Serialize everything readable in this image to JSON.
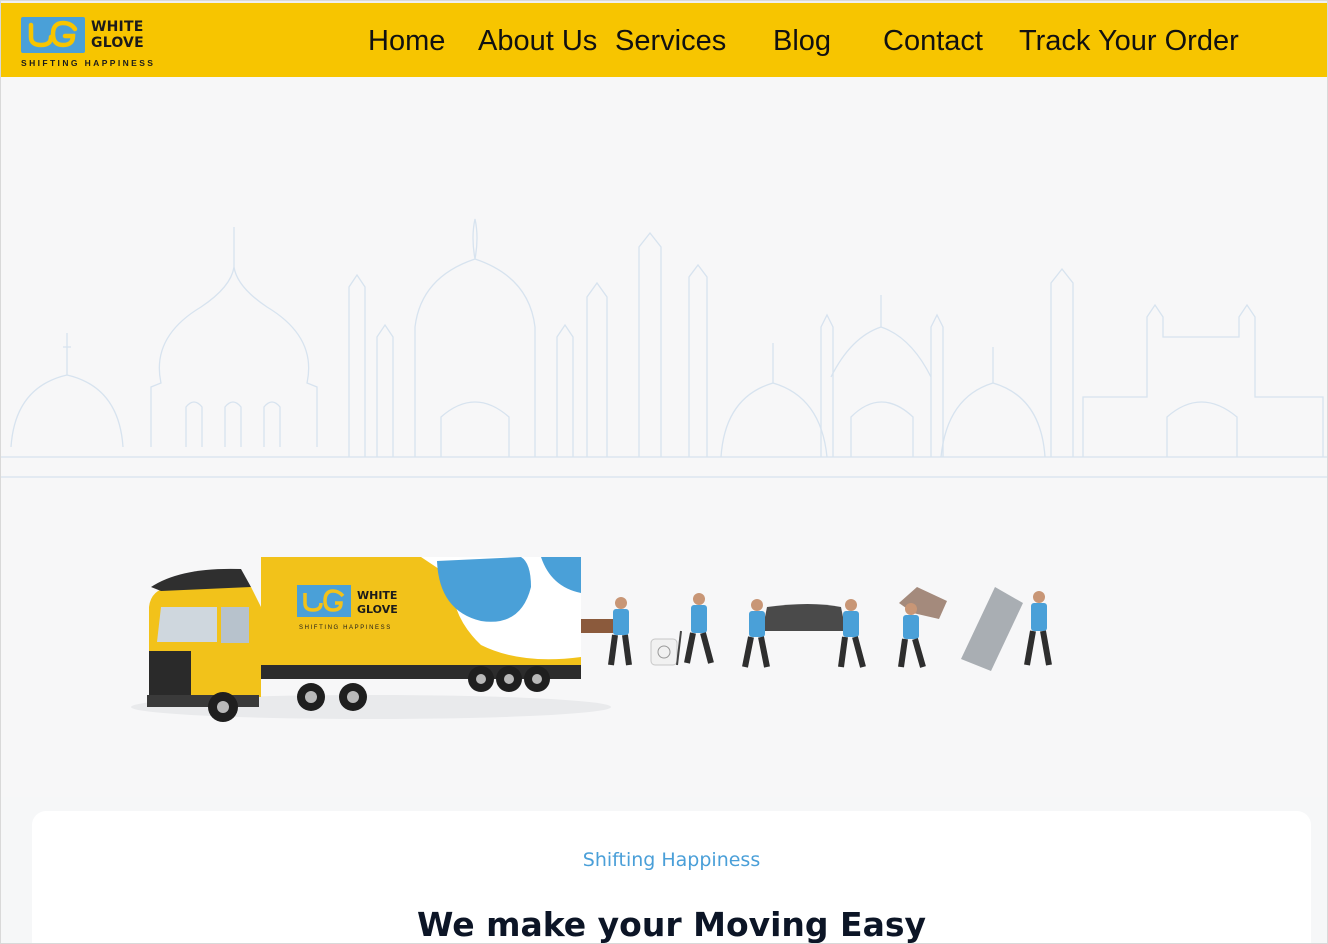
{
  "brand": {
    "name_line1": "WHITE",
    "name_line2": "GLOVE",
    "tagline": "SHIFTING HAPPINESS",
    "truck_name_line1": "WHITE",
    "truck_name_line2": "GLOVE",
    "truck_tagline": "SHIFTING HAPPINESS",
    "primary_color": "#f7c500",
    "accent_color": "#4aa0d8"
  },
  "nav": {
    "items": [
      {
        "label": "Home"
      },
      {
        "label": "About Us"
      },
      {
        "label": "Services"
      },
      {
        "label": "Blog"
      },
      {
        "label": "Contact"
      },
      {
        "label": "Track Your Order"
      }
    ]
  },
  "hero": {
    "illustration": "skyline-icon",
    "scene": "moving-truck-and-movers"
  },
  "intro": {
    "subtitle": "Shifting Happiness",
    "title": "We make your Moving Easy"
  }
}
